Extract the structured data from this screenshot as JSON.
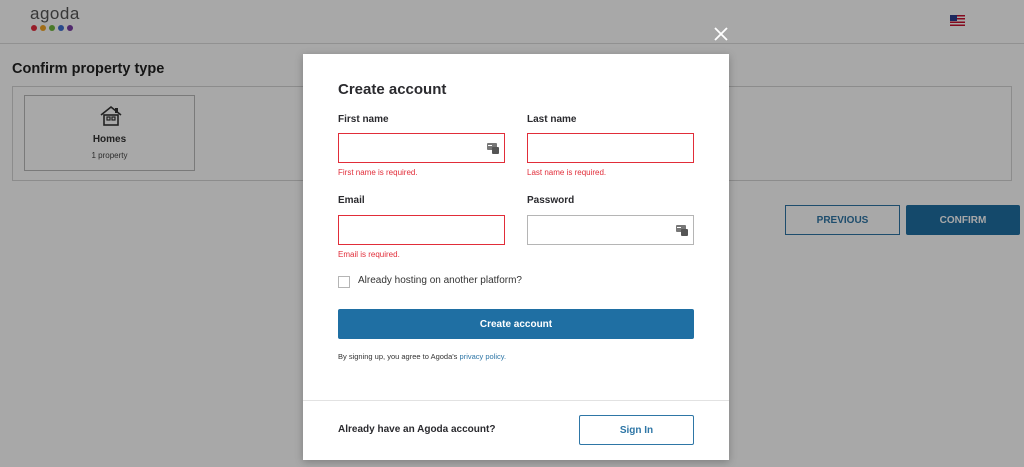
{
  "header": {
    "logo_text": "agoda",
    "logo_dot_colors": [
      "#e52d3e",
      "#f5a623",
      "#6fb83e",
      "#3e6fd3",
      "#7b3fa6"
    ],
    "flag_icon": "us-flag-icon"
  },
  "page": {
    "title": "Confirm property type",
    "property_card": {
      "icon": "home-icon",
      "title": "Homes",
      "subtitle": "1 property"
    },
    "previous_label": "PREVIOUS",
    "confirm_label": "CONFIRM"
  },
  "modal": {
    "close_icon": "close-icon",
    "title": "Create account",
    "first_name": {
      "label": "First name",
      "value": "",
      "error": "First name is required."
    },
    "last_name": {
      "label": "Last name",
      "value": "",
      "error": "Last name is required."
    },
    "email": {
      "label": "Email",
      "value": "",
      "error": "Email is required."
    },
    "password": {
      "label": "Password",
      "value": ""
    },
    "checkbox_label": "Already hosting on another platform?",
    "checkbox_checked": false,
    "create_button": "Create account",
    "terms_prefix": "By signing up, you agree to Agoda's",
    "terms_link": "privacy policy.",
    "footer_text": "Already have an Agoda account?",
    "signin_button": "Sign In"
  },
  "colors": {
    "primary": "#1f6fa3",
    "error": "#e12d39"
  }
}
